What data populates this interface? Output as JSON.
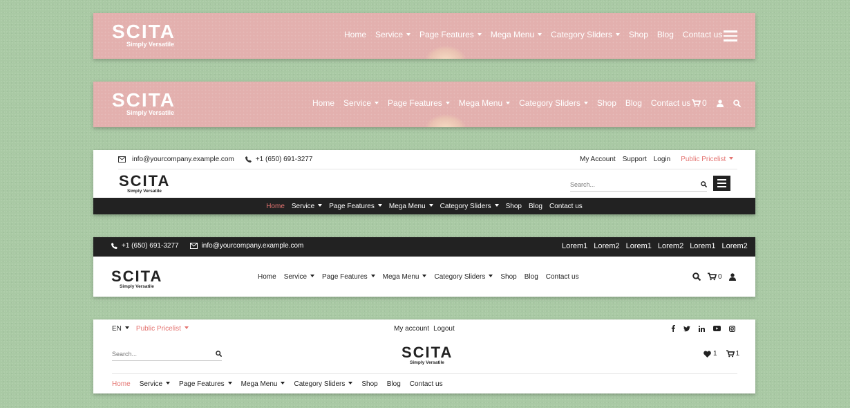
{
  "colors": {
    "accent": "#e47471",
    "dark_bar": "#222222",
    "background": "#a9c9a4",
    "pink_banner": "#e3b0ae"
  },
  "brand": {
    "name": "SCITA",
    "tagline": "Simply Versatile"
  },
  "nav": {
    "home": "Home",
    "service": "Service",
    "page_features": "Page Features",
    "mega_menu": "Mega Menu",
    "category_sliders": "Category Sliders",
    "shop": "Shop",
    "blog": "Blog",
    "contact": "Contact us"
  },
  "header1": {
    "menu_icon": "hamburger-icon"
  },
  "header2": {
    "cart_count": "0",
    "icons": [
      "cart-icon",
      "user-icon",
      "search-icon"
    ]
  },
  "header3": {
    "email": "info@yourcompany.example.com",
    "phone": "+1 (650) 691-3277",
    "links": [
      "My Account",
      "Support",
      "Login"
    ],
    "pricelist": "Public Pricelist",
    "search_placeholder": "Search..."
  },
  "header4": {
    "phone": "+1 (650) 691-3277",
    "email": "info@yourcompany.example.com",
    "top_links": [
      "Lorem1",
      "Lorem2",
      "Lorem1",
      "Lorem2",
      "Lorem1",
      "Lorem2"
    ],
    "cart_count": "0"
  },
  "header5": {
    "language": "EN",
    "pricelist": "Public Pricelist",
    "my_account": "My account",
    "logout": "Logout",
    "social_icons": [
      "facebook-icon",
      "twitter-icon",
      "linkedin-icon",
      "youtube-icon",
      "instagram-icon"
    ],
    "search_placeholder": "Search...",
    "wishlist_count": "1",
    "cart_count": "1"
  }
}
